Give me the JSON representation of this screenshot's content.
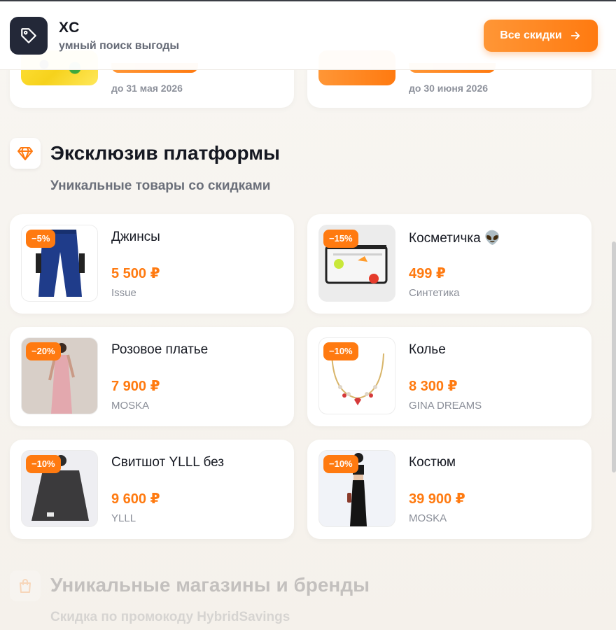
{
  "header": {
    "title": "XC",
    "subtitle": "умный поиск выгоды",
    "cta_label": "Все скидки",
    "logo_icon": "tag-icon",
    "cta_icon": "arrow-right-icon"
  },
  "top_cards": [
    {
      "date": "до 31 мая 2026"
    },
    {
      "date": "до 30 июня 2026"
    }
  ],
  "section": {
    "icon": "diamond-icon",
    "title": "Эксклюзив платформы",
    "subtitle": "Уникальные товары со скидками"
  },
  "products": [
    {
      "name": "Джинсы",
      "price": "5 500 ₽",
      "brand": "Issue",
      "discount": "−5%"
    },
    {
      "name": "Косметичка 👽",
      "price": "499 ₽",
      "brand": "Синтетика",
      "discount": "−15%"
    },
    {
      "name": "Розовое платье",
      "price": "7 900 ₽",
      "brand": "MOSKA",
      "discount": "−20%"
    },
    {
      "name": "Колье",
      "price": "8 300 ₽",
      "brand": "GINA DREAMS",
      "discount": "−10%"
    },
    {
      "name": "Свитшот YLLL без",
      "price": "9 600 ₽",
      "brand": "YLLL",
      "discount": "−10%"
    },
    {
      "name": "Костюм",
      "price": "39 900 ₽",
      "brand": "MOSKA",
      "discount": "−10%"
    }
  ],
  "next_section": {
    "icon": "shopping-bag-icon",
    "title": "Уникальные магазины и бренды",
    "subtitle": "Скидка по промокоду HybridSavings"
  },
  "colors": {
    "accent": "#ff7a10",
    "dark": "#232838",
    "background": "#f6f3ee"
  }
}
